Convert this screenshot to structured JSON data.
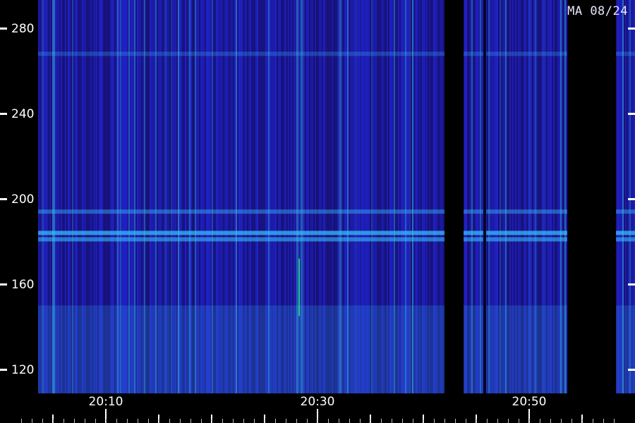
{
  "station_label": "MA 08/24",
  "chart_data": {
    "type": "heatmap",
    "title": "",
    "xlabel": "",
    "ylabel": "",
    "x_ticks": [
      "20:10",
      "20:30",
      "20:50"
    ],
    "x_tick_minutes": [
      10,
      30,
      50
    ],
    "y_ticks": [
      280,
      240,
      200,
      160,
      120
    ],
    "x_range_minutes": [
      2,
      60
    ],
    "y_range": [
      108,
      292
    ],
    "data_gaps_minutes": [
      [
        -4,
        3.6
      ],
      [
        42.0,
        43.8
      ],
      [
        53.6,
        58.2
      ]
    ],
    "dark_stripe_minutes": [
      45.8
    ],
    "bright_bands": [
      {
        "y": 184,
        "level": 0.7
      },
      {
        "y": 181,
        "level": 0.55
      },
      {
        "y": 194,
        "level": 0.4
      },
      {
        "y": 268,
        "level": 0.25
      }
    ],
    "colors": {
      "background": "#000000",
      "low": "#1a0a5a",
      "mid": "#2a2aff",
      "high": "#39c8ff",
      "accent": "#30ff80"
    }
  }
}
